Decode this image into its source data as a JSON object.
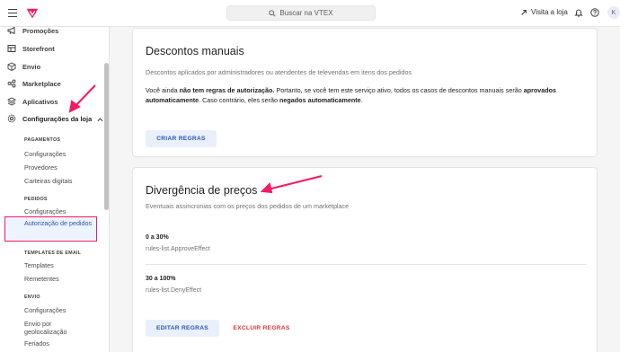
{
  "topbar": {
    "search_placeholder": "Buscar na VTEX",
    "visit_store": "Visita a loja",
    "avatar_initial": "K"
  },
  "sidebar": {
    "items": [
      {
        "label": "Promoções",
        "icon": "megaphone-icon"
      },
      {
        "label": "Storefront",
        "icon": "storefront-icon"
      },
      {
        "label": "Envio",
        "icon": "box-icon"
      },
      {
        "label": "Marketplace",
        "icon": "marketplace-icon"
      },
      {
        "label": "Aplicativos",
        "icon": "apps-icon"
      },
      {
        "label": "Configurações da loja",
        "icon": "gear-icon"
      }
    ],
    "sections": [
      {
        "header": "PAGAMENTOS",
        "items": [
          "Configurações",
          "Provedores",
          "Carteiras digitais"
        ]
      },
      {
        "header": "PEDIDOS",
        "items": [
          "Configurações",
          "Autorização de pedidos"
        ]
      },
      {
        "header": "TEMPLATES DE EMAIL",
        "items": [
          "Templates",
          "Remetentes"
        ]
      },
      {
        "header": "ENVIO",
        "items": [
          "Configurações",
          "Envio por geolocalização",
          "Feriados"
        ]
      }
    ],
    "active_item": "Autorização de pedidos"
  },
  "manual_discounts": {
    "title": "Descontos manuais",
    "subtitle": "Descontos aplicados por administradores ou atendentes de televendas em itens dos pedidos",
    "text_1": "Você ainda ",
    "text_2": "não tem regras de autorização.",
    "text_3": " Portanto, se você tem este serviço ativo, todos os casos de descontos manuais serão ",
    "text_4": "aprovados automaticamente",
    "text_5": ". Caso contrário, eles serão ",
    "text_6": "negados automaticamente",
    "text_7": ".",
    "button": "CRIAR REGRAS"
  },
  "price_divergence": {
    "title": "Divergência de preços",
    "subtitle": "Eventuais assincronias com os preços dos pedidos de um marketplace",
    "rules": [
      {
        "range": "0 a 30%",
        "effect": "rules-list.ApproveEffect"
      },
      {
        "range": "30 a 100%",
        "effect": "rules-list.DenyEffect"
      }
    ],
    "edit_button": "EDITAR REGRAS",
    "delete_button": "EXCLUIR REGRAS"
  },
  "colors": {
    "accent": "#f71963",
    "link_blue": "#2953b2",
    "danger": "#e13232"
  }
}
